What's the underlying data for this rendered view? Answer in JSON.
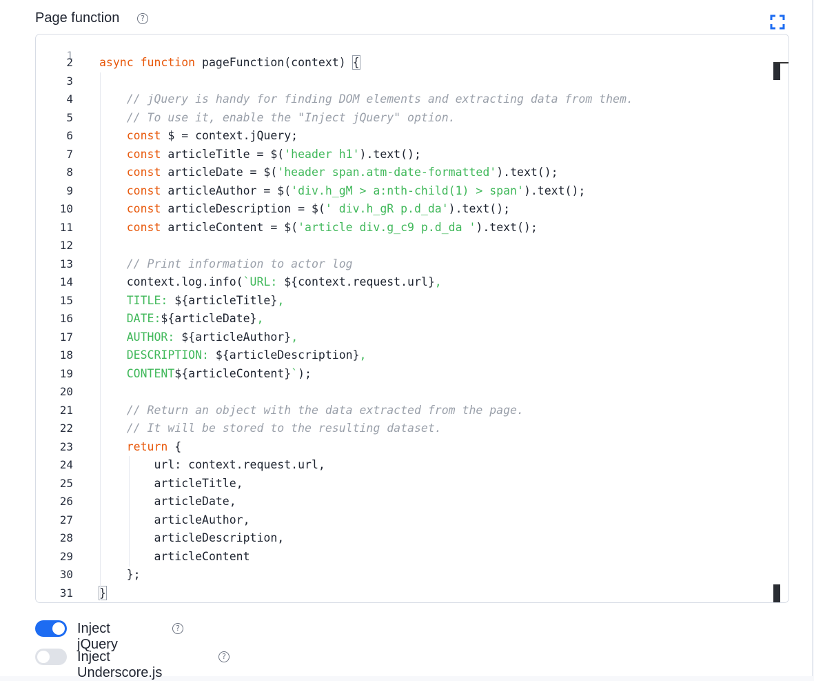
{
  "header": {
    "title": "Page function",
    "help_icon": "help-circle-icon",
    "fullscreen_icon": "fullscreen-icon"
  },
  "colors": {
    "keyword": "#e8590c",
    "string": "#40b85a",
    "comment": "#9aa0aa",
    "toggle_on": "#1d6cf2",
    "toggle_off": "#dfe2e8"
  },
  "editor": {
    "first_line_number": "1",
    "lines": [
      {
        "n": "2",
        "segs": [
          [
            "kw",
            "async function"
          ],
          [
            "t",
            " pageFunction(context) "
          ],
          [
            "br",
            "{"
          ]
        ]
      },
      {
        "n": "3",
        "segs": []
      },
      {
        "n": "4",
        "segs": [
          [
            "t",
            "    "
          ],
          [
            "cm",
            "// jQuery is handy for finding DOM elements and extracting data from them."
          ]
        ]
      },
      {
        "n": "5",
        "segs": [
          [
            "t",
            "    "
          ],
          [
            "cm",
            "// To use it, enable the \"Inject jQuery\" option."
          ]
        ]
      },
      {
        "n": "6",
        "segs": [
          [
            "t",
            "    "
          ],
          [
            "kw",
            "const"
          ],
          [
            "t",
            " $ = context.jQuery;"
          ]
        ]
      },
      {
        "n": "7",
        "segs": [
          [
            "t",
            "    "
          ],
          [
            "kw",
            "const"
          ],
          [
            "t",
            " articleTitle = $("
          ],
          [
            "str",
            "'header h1'"
          ],
          [
            "t",
            ").text();"
          ]
        ]
      },
      {
        "n": "8",
        "segs": [
          [
            "t",
            "    "
          ],
          [
            "kw",
            "const"
          ],
          [
            "t",
            " articleDate = $("
          ],
          [
            "str",
            "'header span.atm-date-formatted'"
          ],
          [
            "t",
            ").text();"
          ]
        ]
      },
      {
        "n": "9",
        "segs": [
          [
            "t",
            "    "
          ],
          [
            "kw",
            "const"
          ],
          [
            "t",
            " articleAuthor = $("
          ],
          [
            "str",
            "'div.h_gM > a:nth-child(1) > span'"
          ],
          [
            "t",
            ").text();"
          ]
        ]
      },
      {
        "n": "10",
        "segs": [
          [
            "t",
            "    "
          ],
          [
            "kw",
            "const"
          ],
          [
            "t",
            " articleDescription = $("
          ],
          [
            "str",
            "' div.h_gR p.d_da'"
          ],
          [
            "t",
            ").text();"
          ]
        ]
      },
      {
        "n": "11",
        "segs": [
          [
            "t",
            "    "
          ],
          [
            "kw",
            "const"
          ],
          [
            "t",
            " articleContent = $("
          ],
          [
            "str",
            "'article div.g_c9 p.d_da '"
          ],
          [
            "t",
            ").text();"
          ]
        ]
      },
      {
        "n": "12",
        "segs": []
      },
      {
        "n": "13",
        "segs": [
          [
            "t",
            "    "
          ],
          [
            "cm",
            "// Print information to actor log"
          ]
        ]
      },
      {
        "n": "14",
        "segs": [
          [
            "t",
            "    context.log.info("
          ],
          [
            "str",
            "`URL: "
          ],
          [
            "t",
            "${context.request.url}"
          ],
          [
            "str",
            ","
          ]
        ]
      },
      {
        "n": "15",
        "segs": [
          [
            "t",
            "    "
          ],
          [
            "str",
            "TITLE: "
          ],
          [
            "t",
            "${articleTitle}"
          ],
          [
            "str",
            ","
          ]
        ]
      },
      {
        "n": "16",
        "segs": [
          [
            "t",
            "    "
          ],
          [
            "str",
            "DATE:"
          ],
          [
            "t",
            "${articleDate}"
          ],
          [
            "str",
            ","
          ]
        ]
      },
      {
        "n": "17",
        "segs": [
          [
            "t",
            "    "
          ],
          [
            "str",
            "AUTHOR: "
          ],
          [
            "t",
            "${articleAuthor}"
          ],
          [
            "str",
            ","
          ]
        ]
      },
      {
        "n": "18",
        "segs": [
          [
            "t",
            "    "
          ],
          [
            "str",
            "DESCRIPTION: "
          ],
          [
            "t",
            "${articleDescription}"
          ],
          [
            "str",
            ","
          ]
        ]
      },
      {
        "n": "19",
        "segs": [
          [
            "t",
            "    "
          ],
          [
            "str",
            "CONTENT"
          ],
          [
            "t",
            "${articleContent}"
          ],
          [
            "str",
            "`"
          ],
          [
            "t",
            ");"
          ]
        ]
      },
      {
        "n": "20",
        "segs": []
      },
      {
        "n": "21",
        "segs": [
          [
            "t",
            "    "
          ],
          [
            "cm",
            "// Return an object with the data extracted from the page."
          ]
        ]
      },
      {
        "n": "22",
        "segs": [
          [
            "t",
            "    "
          ],
          [
            "cm",
            "// It will be stored to the resulting dataset."
          ]
        ]
      },
      {
        "n": "23",
        "segs": [
          [
            "t",
            "    "
          ],
          [
            "kw",
            "return"
          ],
          [
            "t",
            " {"
          ]
        ]
      },
      {
        "n": "24",
        "segs": [
          [
            "t",
            "        url: context.request.url,"
          ]
        ]
      },
      {
        "n": "25",
        "segs": [
          [
            "t",
            "        articleTitle,"
          ]
        ]
      },
      {
        "n": "26",
        "segs": [
          [
            "t",
            "        articleDate,"
          ]
        ]
      },
      {
        "n": "27",
        "segs": [
          [
            "t",
            "        articleAuthor,"
          ]
        ]
      },
      {
        "n": "28",
        "segs": [
          [
            "t",
            "        articleDescription,"
          ]
        ]
      },
      {
        "n": "29",
        "segs": [
          [
            "t",
            "        articleContent"
          ]
        ]
      },
      {
        "n": "30",
        "segs": [
          [
            "t",
            "    };"
          ]
        ]
      },
      {
        "n": "31",
        "segs": [
          [
            "br",
            "}"
          ]
        ]
      }
    ]
  },
  "options": {
    "inject_jquery": {
      "label": "Inject jQuery",
      "enabled": true
    },
    "inject_underscore": {
      "label": "Inject Underscore.js",
      "enabled": false
    }
  }
}
